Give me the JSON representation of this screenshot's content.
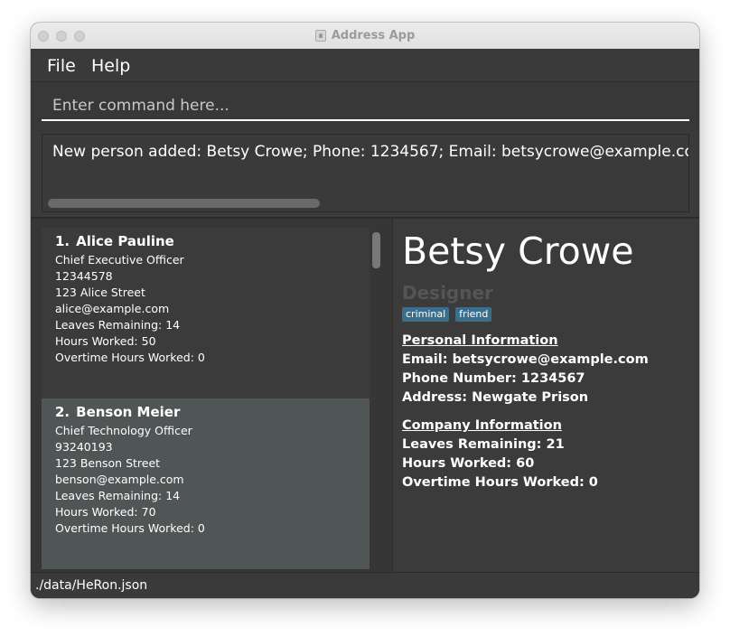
{
  "window": {
    "title": "Address App",
    "icon": "app-icon"
  },
  "menu": {
    "file": "File",
    "help": "Help"
  },
  "command": {
    "placeholder": "Enter command here...",
    "value": ""
  },
  "result": {
    "text": "New person added: Betsy Crowe; Phone: 1234567; Email: betsycrowe@example.com; Address: Newgate Prison; Tags: [criminal][friend]"
  },
  "persons": [
    {
      "index": "1.",
      "name": "Alice Pauline",
      "role": "Chief Executive Officer",
      "phone": "12344578",
      "address": "123 Alice Street",
      "email": "alice@example.com",
      "leaves": "Leaves Remaining: 14",
      "hours": "Hours Worked: 50",
      "overtime": "Overtime Hours Worked: 0"
    },
    {
      "index": "2.",
      "name": "Benson Meier",
      "role": "Chief Technology Officer",
      "phone": "93240193",
      "address": "123 Benson Street",
      "email": "benson@example.com",
      "leaves": "Leaves Remaining: 14",
      "hours": "Hours Worked: 70",
      "overtime": "Overtime Hours Worked: 0"
    }
  ],
  "detail": {
    "name": "Betsy Crowe",
    "role": "Designer",
    "tags": [
      "criminal",
      "friend"
    ],
    "personal_heading": "Personal Information",
    "email": "Email: betsycrowe@example.com",
    "phone": "Phone Number: 1234567",
    "address": "Address: Newgate Prison",
    "company_heading": "Company Information",
    "leaves": "Leaves Remaining: 21",
    "hours": "Hours Worked: 60",
    "overtime": "Overtime Hours Worked: 0"
  },
  "status": {
    "path": "./data/HeRon.json"
  },
  "colors": {
    "background": "#3b3b3b",
    "selected_card": "#505556",
    "tag": "#3c6e8b",
    "role_muted": "#555555"
  }
}
